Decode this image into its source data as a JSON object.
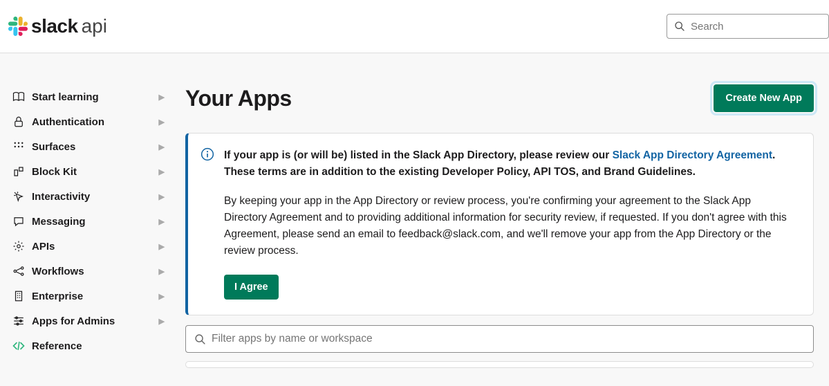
{
  "header": {
    "logo_bold": "slack",
    "logo_light": "api",
    "search_placeholder": "Search"
  },
  "sidebar": {
    "items": [
      {
        "label": "Start learning",
        "has_chevron": true
      },
      {
        "label": "Authentication",
        "has_chevron": true
      },
      {
        "label": "Surfaces",
        "has_chevron": true
      },
      {
        "label": "Block Kit",
        "has_chevron": true
      },
      {
        "label": "Interactivity",
        "has_chevron": true
      },
      {
        "label": "Messaging",
        "has_chevron": true
      },
      {
        "label": "APIs",
        "has_chevron": true
      },
      {
        "label": "Workflows",
        "has_chevron": true
      },
      {
        "label": "Enterprise",
        "has_chevron": true
      },
      {
        "label": "Apps for Admins",
        "has_chevron": true
      },
      {
        "label": "Reference",
        "has_chevron": false
      }
    ]
  },
  "main": {
    "title": "Your Apps",
    "create_button": "Create New App",
    "notice": {
      "p1_prefix": "If your app is (or will be) listed in the Slack App Directory, please review our ",
      "p1_link": "Slack App Directory Agreement",
      "p1_suffix": ". These terms are in addition to the existing Developer Policy, API TOS, and Brand Guidelines.",
      "p2": "By keeping your app in the App Directory or review process, you're confirming your agreement to the Slack App Directory Agreement and to providing additional information for security review, if requested. If you don't agree with this Agreement, please send an email to feedback@slack.com, and we'll remove your app from the App Directory or the review process.",
      "agree_button": "I Agree"
    },
    "filter_placeholder": "Filter apps by name or workspace"
  }
}
